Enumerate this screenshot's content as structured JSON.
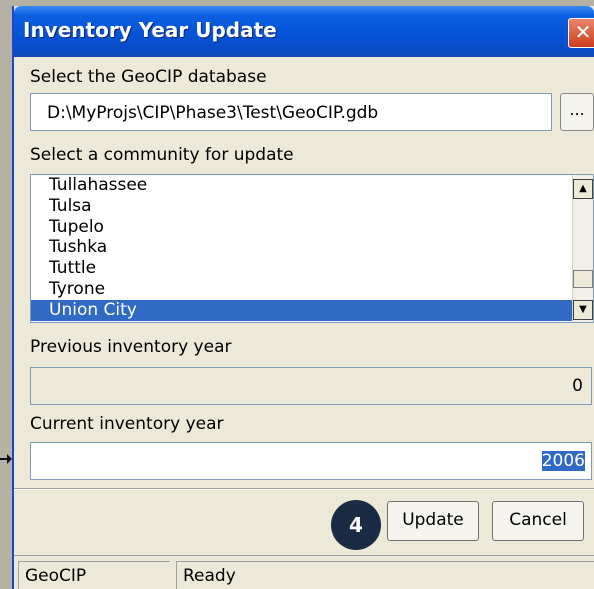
{
  "window": {
    "title": "Inventory Year Update",
    "close_glyph": "✕"
  },
  "database": {
    "label": "Select the GeoCIP database",
    "path": "D:\\MyProjs\\CIP\\Phase3\\Test\\GeoCIP.gdb",
    "browse_label": "..."
  },
  "community": {
    "label": "Select a community for update",
    "items": [
      "Tullahassee",
      "Tulsa",
      "Tupelo",
      "Tushka",
      "Tuttle",
      "Tyrone",
      "Union City"
    ],
    "selected": "Union City"
  },
  "previous_year": {
    "label": "Previous inventory year",
    "value": "0"
  },
  "current_year": {
    "label": "Current inventory year",
    "value": "2006"
  },
  "buttons": {
    "update_label": "Update",
    "cancel_label": "Cancel"
  },
  "callout": {
    "number": "4"
  },
  "statusbar": {
    "app": "GeoCIP",
    "state": "Ready"
  },
  "icons": {
    "scroll_up": "▲",
    "scroll_down": "▼"
  },
  "colors": {
    "title_bar": "#0553d8",
    "selection": "#316ac5",
    "callout": "#1a2b44"
  }
}
